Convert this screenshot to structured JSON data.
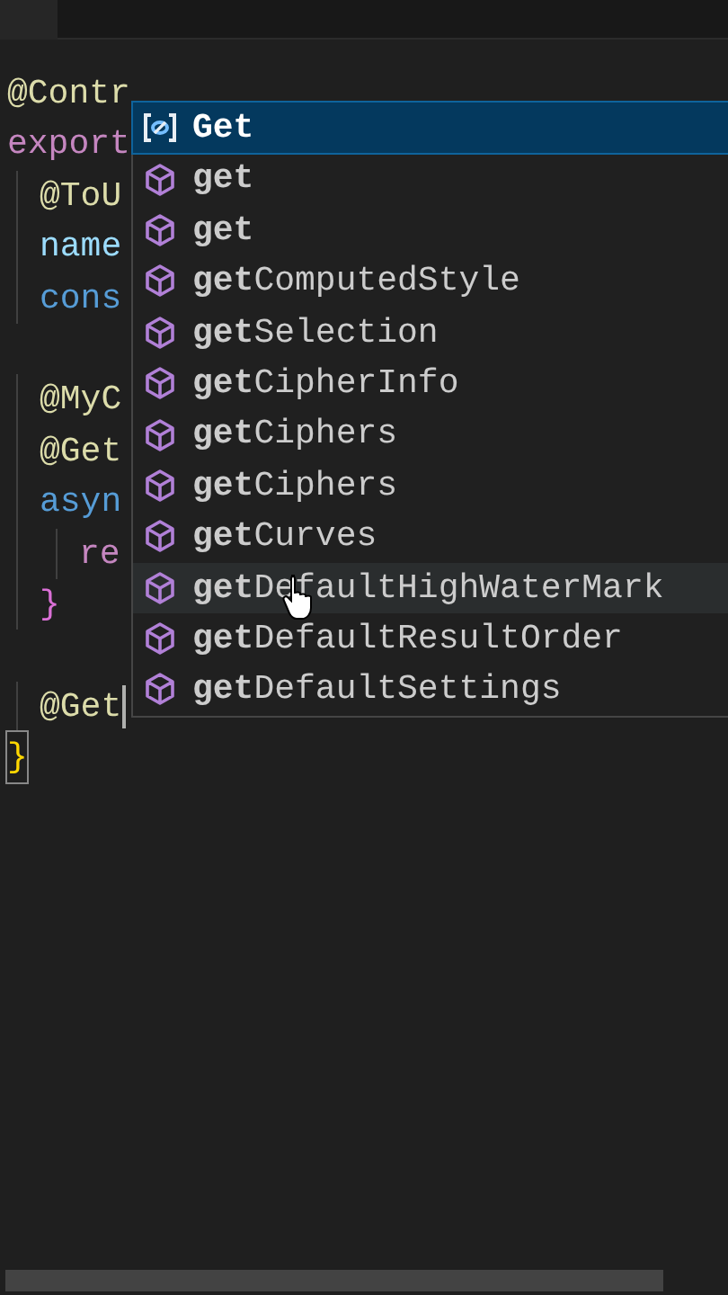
{
  "code_lines": [
    {
      "text": "@Contr",
      "kind": "decorator",
      "children": [
        {
          "text": "@ToU",
          "kind": "decorator"
        },
        {
          "text": "name",
          "kind": "property"
        },
        {
          "text": "cons",
          "kind": "keyword"
        },
        {
          "text": "@MyC",
          "kind": "decorator",
          "gap_before": true
        },
        {
          "text": "@Get",
          "kind": "decorator"
        },
        {
          "text": "asyn",
          "kind": "keyword",
          "children": [
            {
              "text": "re",
              "kind": "control"
            }
          ]
        },
        {
          "text": "}",
          "kind": "brace"
        },
        {
          "text": "@Get",
          "kind": "decorator",
          "gap_before": true,
          "cursor": true
        }
      ]
    },
    {
      "text": "}",
      "kind": "brace-outer"
    }
  ],
  "export_line": {
    "text": "export",
    "kind": "control"
  },
  "suggestions": [
    {
      "label": "**Get**",
      "kind": "variable",
      "selected": true
    },
    {
      "label": "**get**",
      "kind": "method",
      "selected": false
    },
    {
      "label": "**get**",
      "kind": "method",
      "selected": false
    },
    {
      "label": "**get**ComputedStyle",
      "kind": "method",
      "selected": false
    },
    {
      "label": "**get**Selection",
      "kind": "method",
      "selected": false
    },
    {
      "label": "**get**CipherInfo",
      "kind": "method",
      "selected": false
    },
    {
      "label": "**get**Ciphers",
      "kind": "method",
      "selected": false
    },
    {
      "label": "**get**Ciphers",
      "kind": "method",
      "selected": false
    },
    {
      "label": "**get**Curves",
      "kind": "method",
      "selected": false
    },
    {
      "label": "**get**DefaultHighWaterMark",
      "kind": "method",
      "selected": false,
      "hovered": true
    },
    {
      "label": "**get**DefaultResultOrder",
      "kind": "method",
      "selected": false
    },
    {
      "label": "**get**DefaultSettings",
      "kind": "method",
      "selected": false
    }
  ]
}
